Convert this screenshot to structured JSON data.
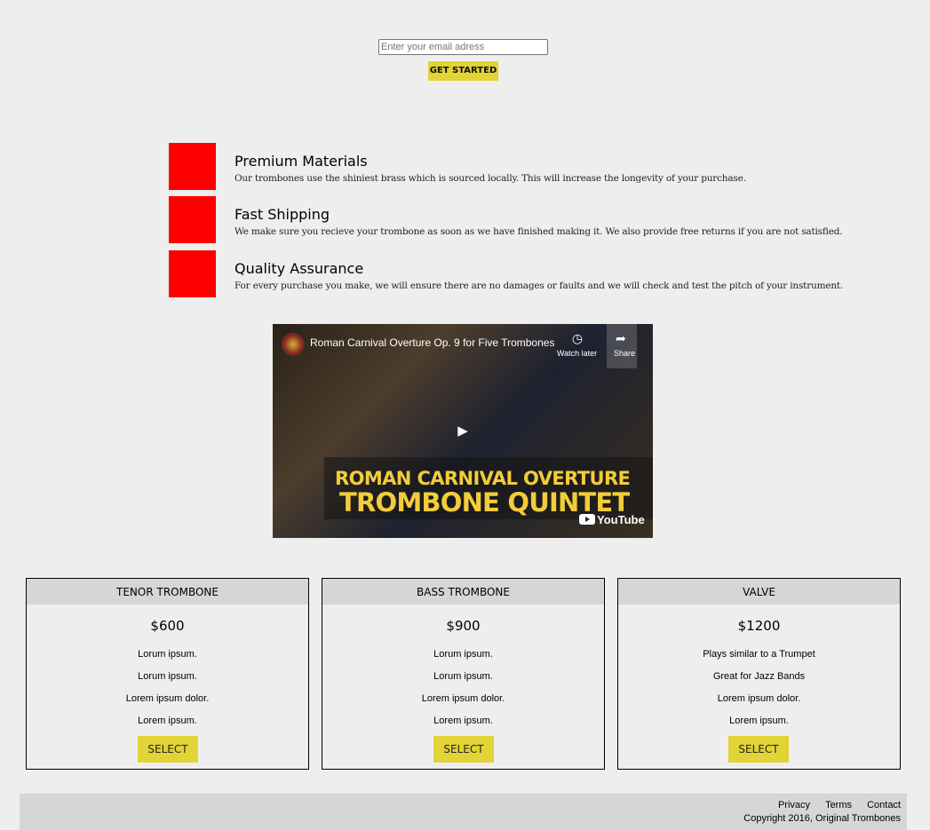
{
  "signup": {
    "email_placeholder": "Enter your email adress",
    "button_label": "GET STARTED"
  },
  "features": [
    {
      "title": "Premium Materials",
      "description": "Our trombones use the shiniest brass which is sourced locally. This will increase the longevity of your purchase."
    },
    {
      "title": "Fast Shipping",
      "description": "We make sure you recieve your trombone as soon as we have finished making it. We also provide free returns if you are not satisfied."
    },
    {
      "title": "Quality Assurance",
      "description": "For every purchase you make, we will ensure there are no damages or faults and we will check and test the pitch of your instrument."
    }
  ],
  "video": {
    "title": "Roman Carnival Overture Op. 9 for Five Trombones",
    "watch_later": "Watch later",
    "share": "Share",
    "thumbnail_line1": "ROMAN CARNIVAL OVERTURE",
    "thumbnail_line2": "TROMBONE QUINTET",
    "youtube_label": "YouTube"
  },
  "pricing": [
    {
      "name": "TENOR TROMBONE",
      "price": "$600",
      "features": [
        "Lorum ipsum.",
        "Lorum ipsum.",
        "Lorem ipsum dolor.",
        "Lorem ipsum."
      ],
      "button": "SELECT"
    },
    {
      "name": "BASS TROMBONE",
      "price": "$900",
      "features": [
        "Lorum ipsum.",
        "Lorum ipsum.",
        "Lorem ipsum dolor.",
        "Lorem ipsum."
      ],
      "button": "SELECT"
    },
    {
      "name": "VALVE",
      "price": "$1200",
      "features": [
        "Plays similar to a Trumpet",
        "Great for Jazz Bands",
        "Lorem ipsum dolor.",
        "Lorem ipsum."
      ],
      "button": "SELECT"
    }
  ],
  "footer": {
    "links": [
      "Privacy",
      "Terms",
      "Contact"
    ],
    "copyright": "Copyright 2016, Original Trombones"
  },
  "colors": {
    "accent_yellow": "#e2d336",
    "feature_red": "#ff0000",
    "page_background": "#eeeeee",
    "panel_gray": "#d6d6d6"
  }
}
